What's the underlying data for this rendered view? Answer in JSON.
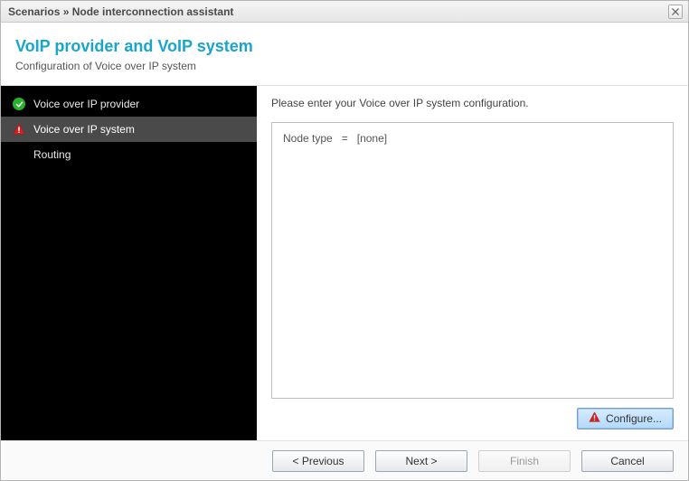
{
  "window": {
    "title": "Scenarios » Node interconnection assistant"
  },
  "header": {
    "heading": "VoIP provider and VoIP system",
    "subheading": "Configuration of Voice over IP system"
  },
  "sidebar": {
    "items": [
      {
        "label": "Voice over IP provider",
        "status": "ok",
        "active": false
      },
      {
        "label": "Voice over IP system",
        "status": "alert",
        "active": true
      },
      {
        "label": "Routing",
        "status": "none",
        "active": false
      }
    ]
  },
  "main": {
    "instruction": "Please enter your Voice over IP system configuration.",
    "config": {
      "node_type_label": "Node type",
      "eq": "=",
      "node_type_value": "[none]"
    },
    "configure_label": "Configure..."
  },
  "footer": {
    "previous_label": "< Previous",
    "next_label": "Next >",
    "finish_label": "Finish",
    "cancel_label": "Cancel"
  },
  "colors": {
    "accent": "#19a6c9",
    "ok": "#28b22e",
    "alert": "#d62020"
  }
}
